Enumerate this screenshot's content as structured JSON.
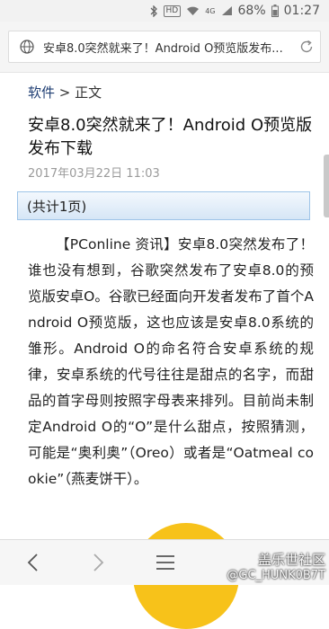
{
  "status_bar": {
    "hd": "HD",
    "network": "4G",
    "battery": "68%",
    "time": "01:27"
  },
  "address_bar": {
    "url_text": "安卓8.0突然就来了！Android O预览版发布..."
  },
  "breadcrumb": {
    "link": "软件",
    "separator": " > ",
    "current": "正文"
  },
  "article": {
    "title": "安卓8.0突然就来了！Android O预览版发布下载",
    "date": "2017年03月22日 11:03",
    "page_count": "(共计1页)",
    "body": "【PConline 资讯】安卓8.0突然发布了！谁也没有想到，谷歌突然发布了安卓8.0的预览版安卓O。谷歌已经面向开发者发布了首个Android O预览版，这也应该是安卓8.0系统的雏形。Android O的命名符合安卓系统的规律，安卓系统的代号往往是甜点的名字，而甜品的首字母则按照字母表来排列。目前尚未制定Android O的“O”是什么甜点，按照猜测，可能是“奥利奥”（Oreo）或者是“Oatmeal cookie”（燕麦饼干）。"
  },
  "watermark": {
    "site": "盖乐世社区",
    "user": "@GC_HUNK0B7T"
  },
  "icons": [
    "bluetooth-icon",
    "wifi-icon",
    "signal-icon",
    "battery-icon",
    "globe-icon",
    "reload-icon",
    "back-icon",
    "forward-icon",
    "menu-icon"
  ]
}
